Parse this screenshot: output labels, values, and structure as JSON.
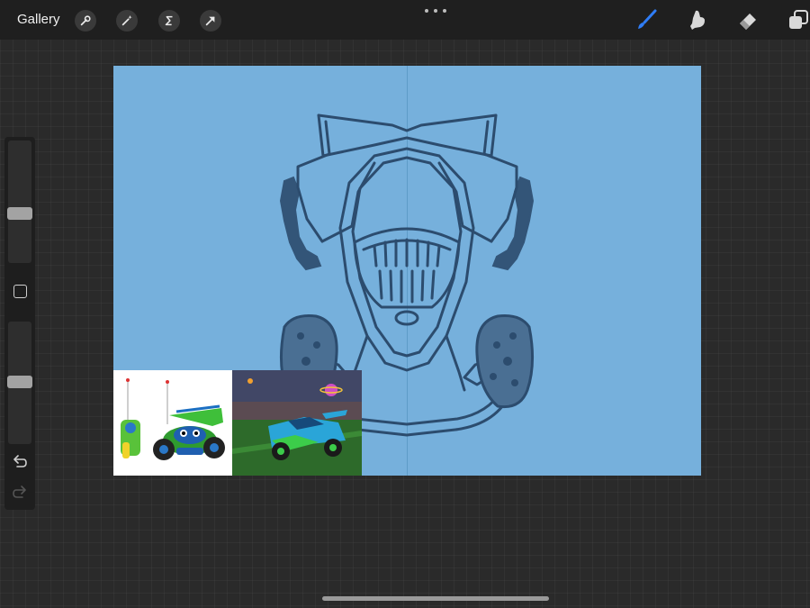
{
  "topbar": {
    "gallery_label": "Gallery",
    "left_tools": [
      {
        "name": "actions",
        "icon": "wrench-icon"
      },
      {
        "name": "adjustments",
        "icon": "magic-wand-icon"
      },
      {
        "name": "selection",
        "icon": "selection-s-icon"
      },
      {
        "name": "transform",
        "icon": "arrow-cursor-icon"
      }
    ],
    "more_icon": "more-dots-icon",
    "right_tools": [
      {
        "name": "brush",
        "icon": "brush-icon",
        "active": true,
        "color": "#2f7df6"
      },
      {
        "name": "smudge",
        "icon": "smudge-finger-icon",
        "active": false
      },
      {
        "name": "eraser",
        "icon": "eraser-icon",
        "active": false
      },
      {
        "name": "layers",
        "icon": "layers-icon",
        "active": false
      }
    ]
  },
  "sidebar": {
    "brush_size_level": 0.6,
    "opacity_level": 0.5,
    "modify_icon": "square-icon",
    "undo_icon": "undo-icon",
    "redo_icon": "redo-icon"
  },
  "canvas": {
    "background_color": "#76b0dc",
    "stroke_color": "#2c4c6e",
    "symmetry_guide": true,
    "reference_images": [
      "toy-rc-car-photo",
      "rocket-league-car-screenshot"
    ]
  }
}
